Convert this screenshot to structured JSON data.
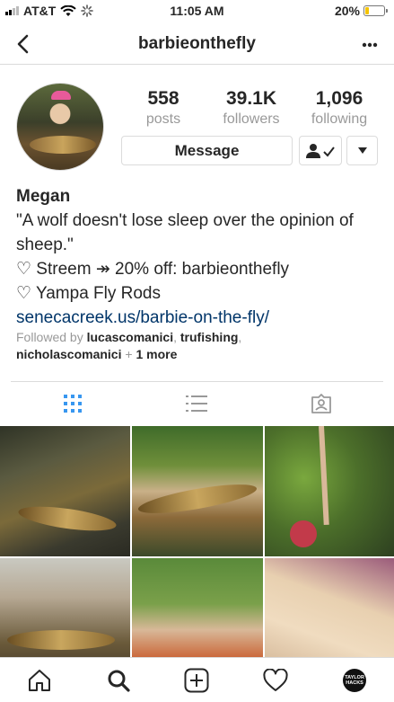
{
  "status_bar": {
    "carrier": "AT&T",
    "time": "11:05 AM",
    "battery_percent": "20%",
    "battery_level": 0.2,
    "signal_bars": 2,
    "battery_color": "#f5c400"
  },
  "header": {
    "username": "barbieonthefly",
    "back_icon": "chevron-left-icon",
    "more_icon": "more-dots-icon"
  },
  "profile": {
    "stats": [
      {
        "value": "558",
        "label": "posts"
      },
      {
        "value": "39.1K",
        "label": "followers"
      },
      {
        "value": "1,096",
        "label": "following"
      }
    ],
    "message_label": "Message",
    "name": "Megan",
    "bio_line1": "\"A wolf doesn't lose sleep over the opinion of sheep.\"",
    "bio_line2": "♡ Streem ↠ 20% off: barbieonthefly",
    "bio_line3": "♡ Yampa Fly Rods",
    "website": "senecacreek.us/barbie-on-the-fly/",
    "followed_by_prefix": "Followed by",
    "followed_user1": "lucascomanici",
    "followed_user2": "trufishing",
    "followed_user3": "nicholascomanici",
    "followed_more": "1 more"
  },
  "tabs": [
    {
      "icon": "grid-icon",
      "active": true
    },
    {
      "icon": "list-icon",
      "active": false
    },
    {
      "icon": "tagged-icon",
      "active": false
    }
  ],
  "accent_color": "#3897f0",
  "link_color": "#003569",
  "bottom_nav": [
    {
      "icon": "home-icon"
    },
    {
      "icon": "search-icon"
    },
    {
      "icon": "new-post-icon"
    },
    {
      "icon": "heart-icon"
    },
    {
      "icon": "profile-avatar-icon"
    }
  ],
  "profile_avatar_text": "TAYLOR HACKS"
}
